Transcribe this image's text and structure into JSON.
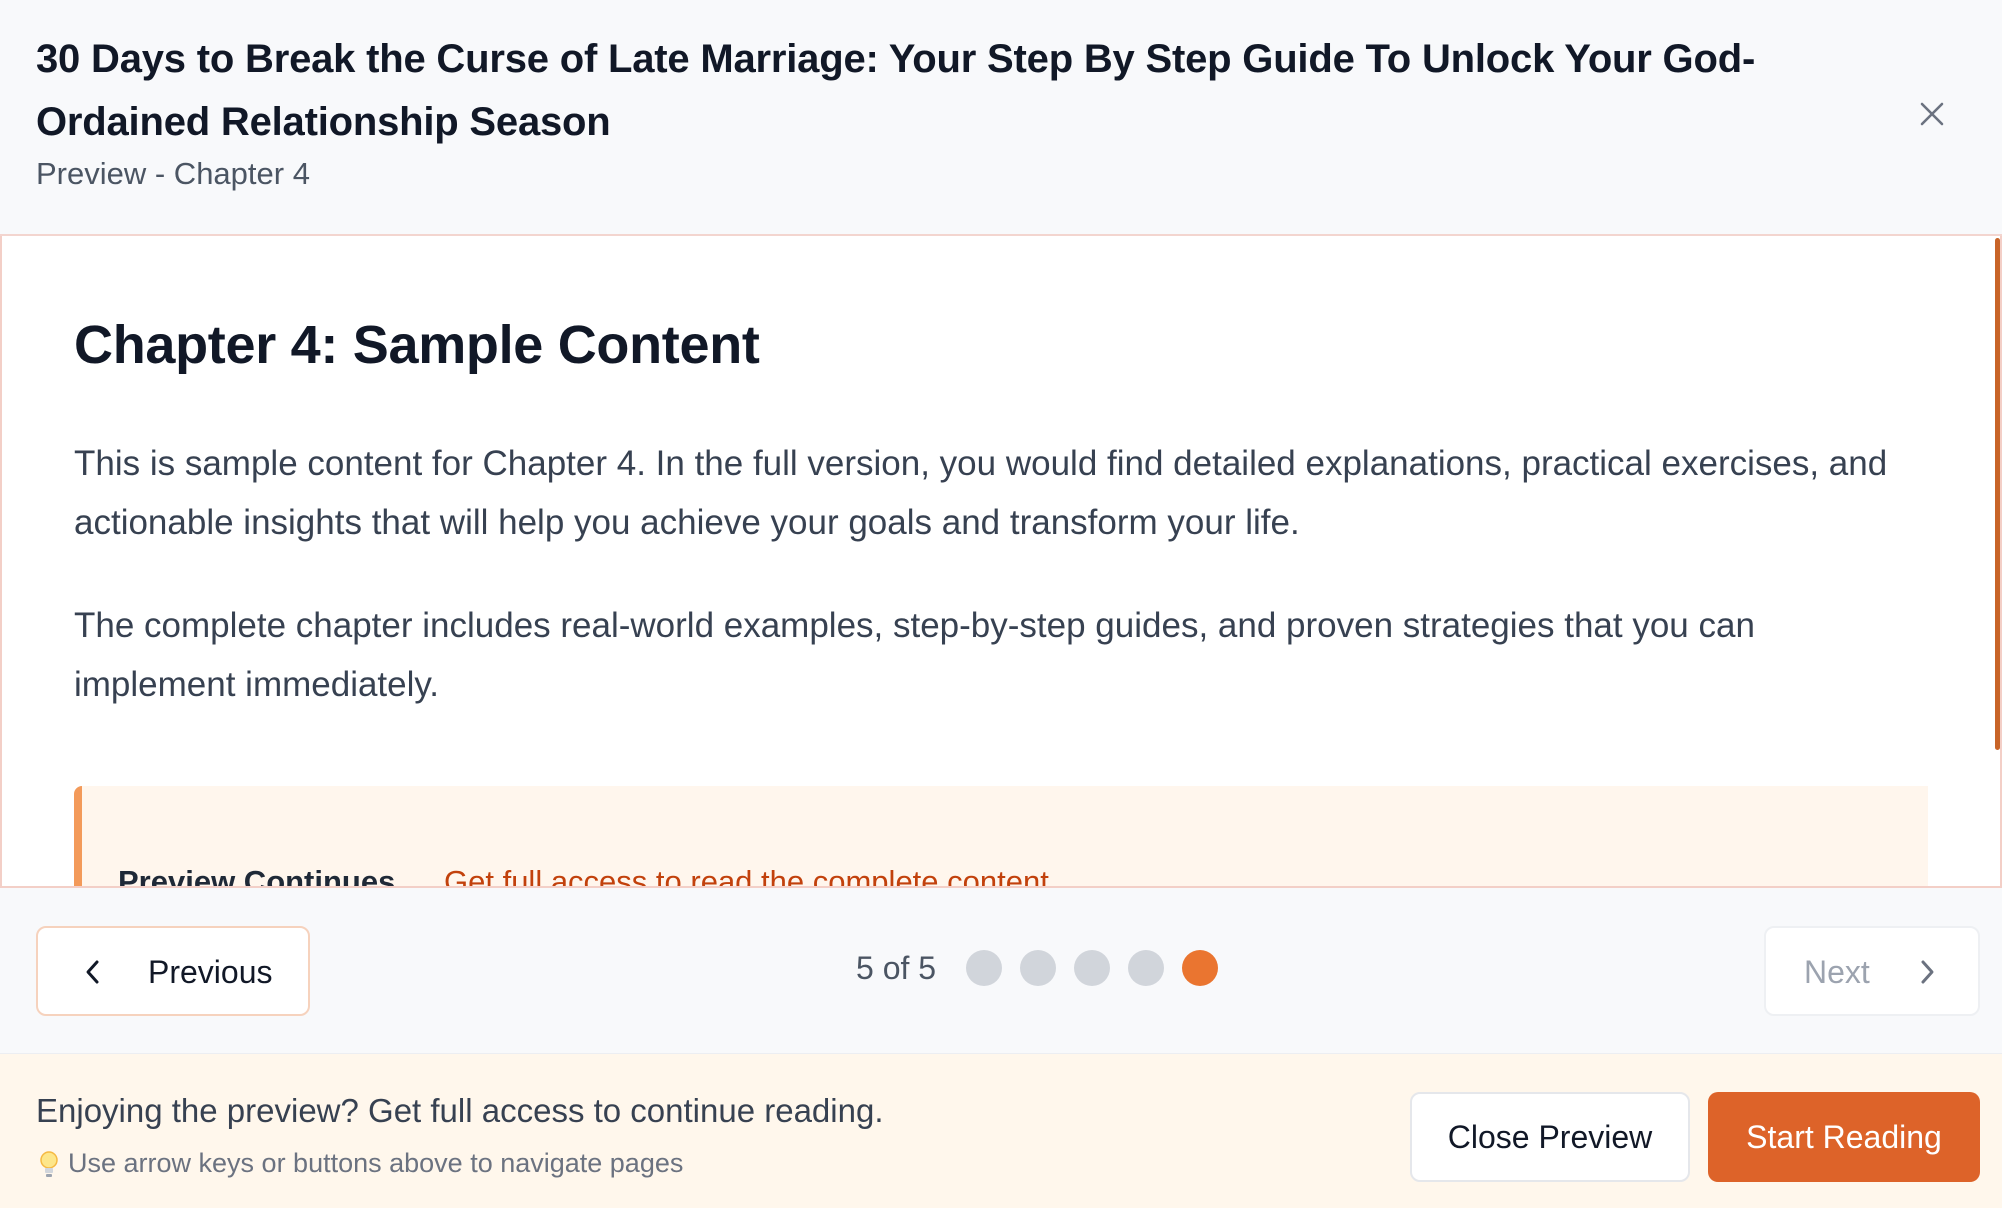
{
  "header": {
    "title": "30 Days to Break the Curse of Late Marriage: Your Step By Step Guide To Unlock Your God-Ordained Relationship Season",
    "subtitle": "Preview - Chapter 4",
    "close_icon": "close-icon"
  },
  "content": {
    "chapter_title": "Chapter 4: Sample Content",
    "paragraphs": [
      "This is sample content for Chapter 4. In the full version, you would find detailed explanations, practical exercises, and actionable insights that will help you achieve your goals and transform your life.",
      "The complete chapter includes real-world examples, step-by-step guides, and proven strategies that you can implement immediately."
    ],
    "preview_notice": {
      "title": "Preview Continues...",
      "link": "Get full access to read the complete content"
    }
  },
  "nav": {
    "previous_label": "Previous",
    "next_label": "Next",
    "page_indicator": "5 of 5",
    "current_page": 5,
    "total_pages": 5
  },
  "footer": {
    "cta_text": "Enjoying the preview? Get full access to continue reading.",
    "hint_text": "Use arrow keys or buttons above to navigate pages",
    "close_preview_label": "Close Preview",
    "start_reading_label": "Start Reading"
  },
  "colors": {
    "accent": "#dd6329",
    "active_dot": "#ea7530",
    "inactive_dot": "#d1d5db",
    "footer_bg": "#fff7ec"
  }
}
